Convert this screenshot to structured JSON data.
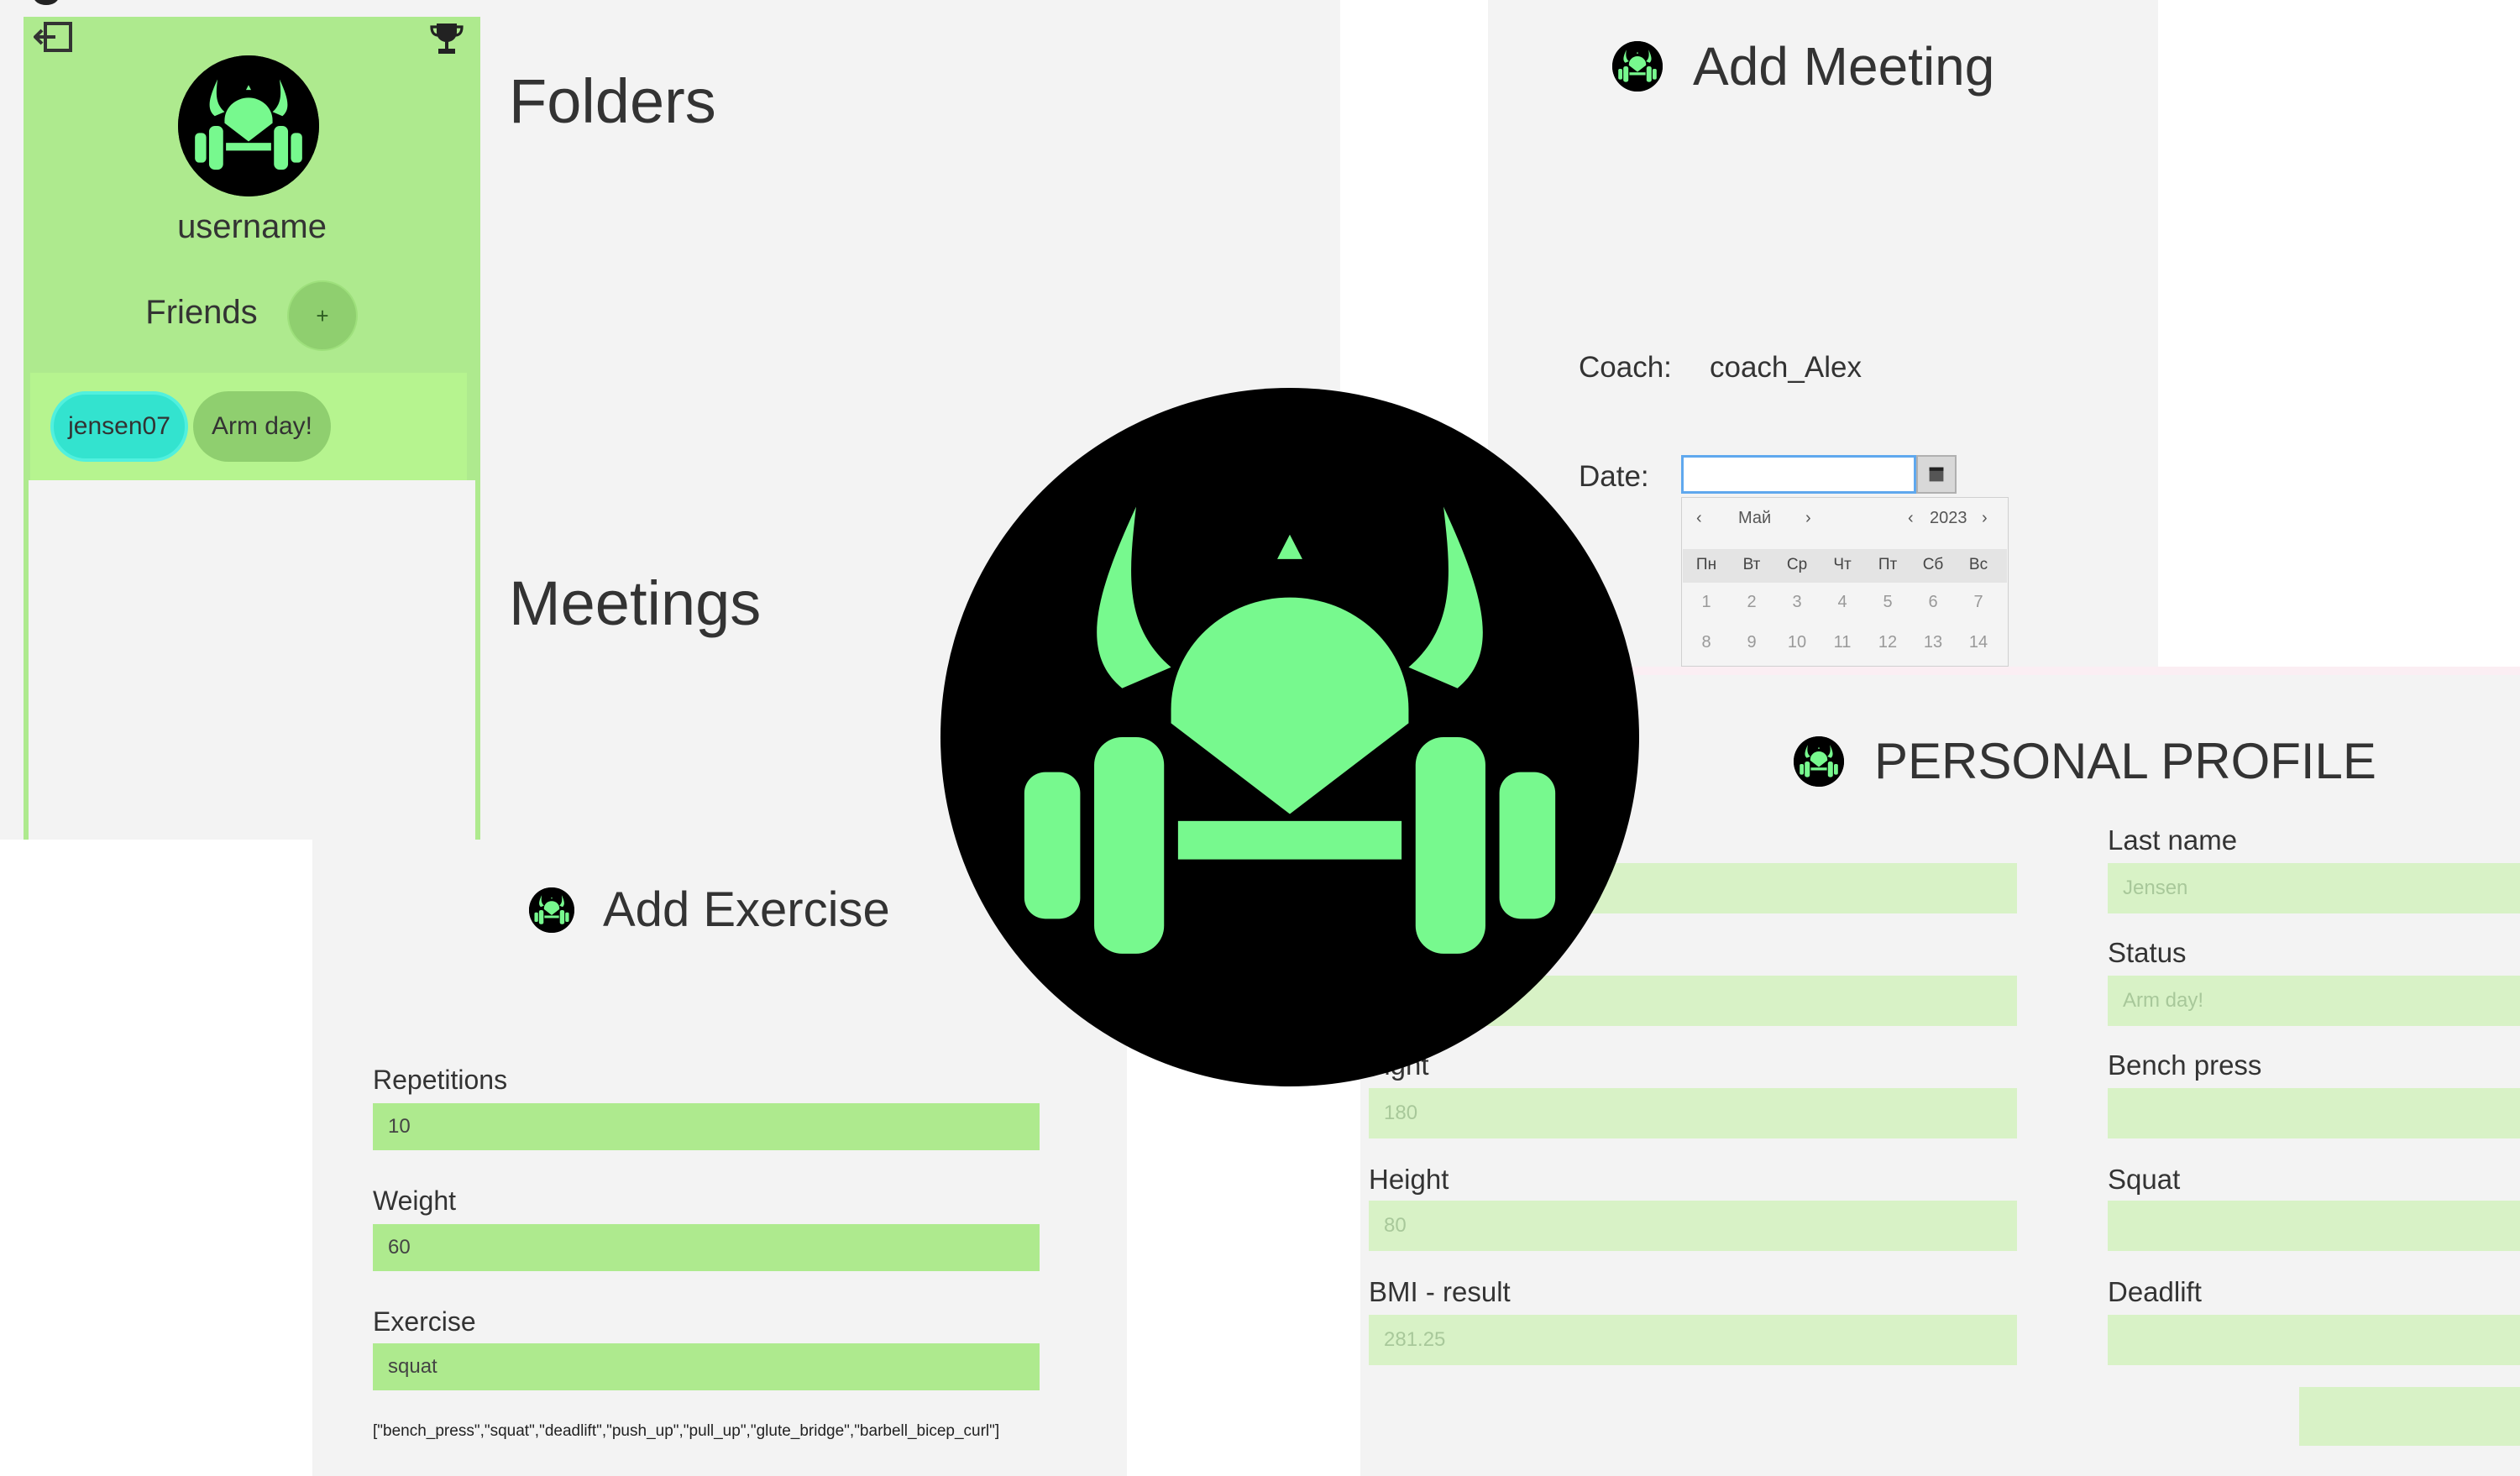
{
  "colors": {
    "accent_green": "#aeea8e",
    "logo_green": "#77f98e",
    "chip_cyan": "#33e3cf",
    "pale_field": "#d8f2c6"
  },
  "main_window": {
    "sidebar": {
      "exit_icon": "exit-icon",
      "trophy_icon": "trophy-icon",
      "username": "username",
      "friends_label": "Friends",
      "add_friend_label": "+",
      "friend": {
        "name": "jensen07",
        "status": "Arm day!"
      }
    },
    "folders_title": "Folders",
    "meetings_title": "Meetings"
  },
  "add_meeting": {
    "title": "Add Meeting",
    "coach_label": "Coach:",
    "coach_value": "coach_Alex",
    "date_label": "Date:",
    "date_value": "",
    "calendar": {
      "month": "Май",
      "year": "2023",
      "weekdays": [
        "Пн",
        "Вт",
        "Ср",
        "Чт",
        "Пт",
        "Сб",
        "Вс"
      ],
      "weeks": [
        [
          "1",
          "2",
          "3",
          "4",
          "5",
          "6",
          "7"
        ],
        [
          "8",
          "9",
          "10",
          "11",
          "12",
          "13",
          "14"
        ]
      ]
    }
  },
  "add_exercise": {
    "title": "Add Exercise",
    "repetitions_label": "Repetitions",
    "repetitions_value": "10",
    "weight_label": "Weight",
    "weight_value": "60",
    "exercise_label": "Exercise",
    "exercise_value": "squat",
    "exercise_list": "[\"bench_press\",\"squat\",\"deadlift\",\"push_up\",\"pull_up\",\"glute_bridge\",\"barbell_bicep_curl\"]"
  },
  "personal_profile": {
    "title": "PERSONAL PROFILE",
    "last_name_label": "Last name",
    "last_name_value": "Jensen",
    "status_label": "Status",
    "status_value": "Arm day!",
    "weight_label": "eight",
    "weight_value": "180",
    "height_label": "Height",
    "height_value": "80",
    "bmi_label": "BMI - result",
    "bmi_value": "281.25",
    "bench_press_label": "Bench press",
    "squat_label": "Squat",
    "deadlift_label": "Deadlift"
  }
}
